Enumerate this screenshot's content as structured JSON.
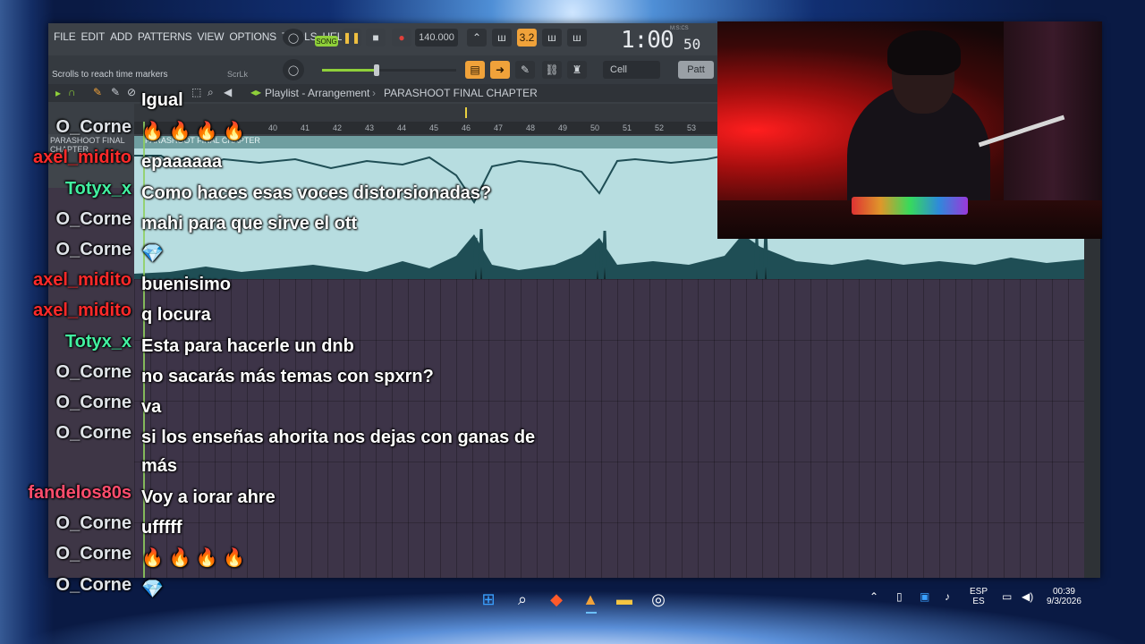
{
  "fl": {
    "menus": [
      "FILE",
      "EDIT",
      "ADD",
      "PATTERNS",
      "VIEW",
      "OPTIONS",
      "TOOLS",
      "HELP"
    ],
    "song_label": "SONG",
    "tempo": "140.000",
    "time_display": "1:00",
    "time_small": "50",
    "time_label": "M:S:CS",
    "hint": "Scrolls to reach time markers",
    "scrlk": "ScrLk",
    "cell_label": "Cell",
    "pat_label": "Patt",
    "step_value": "3.2",
    "breadcrumb": [
      "Playlist - Arrangement",
      "PARASHOOT FINAL CHAPTER"
    ],
    "ruler_ticks": [
      "40",
      "41",
      "42",
      "43",
      "44",
      "45",
      "46",
      "47",
      "48",
      "49",
      "50",
      "51",
      "52",
      "53"
    ],
    "track_name": "PARASHOOT FINAL CHAPTER",
    "clip_name": "PARASHOOT FINAL CHAPTER"
  },
  "chat": {
    "partial_top_text": "Igual",
    "messages": [
      {
        "user": "O_Corne",
        "text": "🔥 🔥 🔥 🔥",
        "user_color": "#dfe3e8"
      },
      {
        "user": "axel_midito",
        "text": "epaaaaaa",
        "user_color": "#ff2a2a"
      },
      {
        "user": "Totyx_x",
        "text": "Como haces esas voces distorsionadas?",
        "user_color": "#42f0a0"
      },
      {
        "user": "O_Corne",
        "text": "mahi para que sirve el ott",
        "user_color": "#dfe3e8"
      },
      {
        "user": "O_Corne",
        "text": "💎",
        "user_color": "#dfe3e8"
      },
      {
        "user": "axel_midito",
        "text": "buenisimo",
        "user_color": "#ff2a2a"
      },
      {
        "user": "axel_midito",
        "text": "q locura",
        "user_color": "#ff2a2a"
      },
      {
        "user": "Totyx_x",
        "text": "Esta para hacerle un dnb",
        "user_color": "#42f0a0"
      },
      {
        "user": "O_Corne",
        "text": "no sacarás más temas con spxrn?",
        "user_color": "#dfe3e8"
      },
      {
        "user": "O_Corne",
        "text": "va",
        "user_color": "#dfe3e8"
      },
      {
        "user": "O_Corne",
        "text": "si los enseñas ahorita nos dejas con ganas de más",
        "user_color": "#dfe3e8"
      },
      {
        "user": "fandelos80s",
        "text": "Voy a iorar ahre",
        "user_color": "#ff4d6d"
      },
      {
        "user": "O_Corne",
        "text": "ufffff",
        "user_color": "#dfe3e8"
      },
      {
        "user": "O_Corne",
        "text": "🔥 🔥 🔥 🔥",
        "user_color": "#dfe3e8"
      },
      {
        "user": "O_Corne",
        "text": "💎",
        "user_color": "#dfe3e8"
      }
    ]
  },
  "taskbar": {
    "lang_top": "ESP",
    "lang_bottom": "ES",
    "clock_time": "00:39",
    "clock_date": "9/3/2026",
    "icons": [
      "windows-start-icon",
      "search-icon",
      "brave-browser-icon",
      "fl-studio-icon",
      "file-explorer-icon",
      "steam-icon"
    ]
  }
}
